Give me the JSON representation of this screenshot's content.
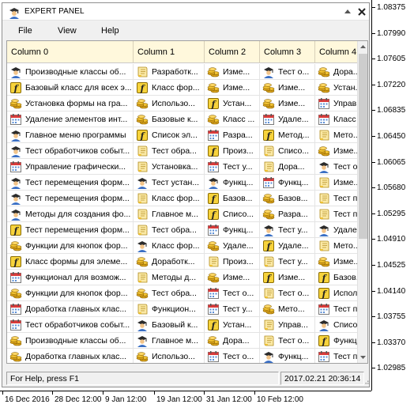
{
  "window": {
    "title": "EXPERT PANEL"
  },
  "menu": [
    "File",
    "View",
    "Help"
  ],
  "table": {
    "columns": [
      "Column 0",
      "Column 1",
      "Column 2",
      "Column 3",
      "Column 4"
    ],
    "rows": [
      [
        [
          "Производные классы об...",
          "wizard-icon"
        ],
        [
          "Разработк...",
          "scroll-icon"
        ],
        [
          "Изме...",
          "coins-icon"
        ],
        [
          "Тест о...",
          "wizard-icon"
        ],
        [
          "Дора...",
          "coins-icon"
        ]
      ],
      [
        [
          "Базовый класс для всех э...",
          "function-icon"
        ],
        [
          "Класс фор...",
          "function-icon"
        ],
        [
          "Изме...",
          "coins-icon"
        ],
        [
          "Изме...",
          "coins-icon"
        ],
        [
          "Устан...",
          "coins-icon"
        ]
      ],
      [
        [
          "Установка формы на гра...",
          "coins-icon"
        ],
        [
          "Использо...",
          "coins-icon"
        ],
        [
          "Устан...",
          "function-icon"
        ],
        [
          "Изме...",
          "coins-icon"
        ],
        [
          "Управ...",
          "calendar-icon"
        ]
      ],
      [
        [
          "Удаление элементов инт...",
          "calendar-icon"
        ],
        [
          "Базовые к...",
          "coins-icon"
        ],
        [
          "Класс ...",
          "coins-icon"
        ],
        [
          "Удале...",
          "calendar-icon"
        ],
        [
          "Класс ...",
          "calendar-icon"
        ]
      ],
      [
        [
          "Главное меню программы",
          "wizard-icon"
        ],
        [
          "Список эл...",
          "function-icon"
        ],
        [
          "Разра...",
          "calendar-icon"
        ],
        [
          "Метод...",
          "function-icon"
        ],
        [
          "Мето...",
          "scroll-icon"
        ]
      ],
      [
        [
          "Тест обработчиков событ...",
          "wizard-icon"
        ],
        [
          "Тест обра...",
          "scroll-icon"
        ],
        [
          "Произ...",
          "function-icon"
        ],
        [
          "Списо...",
          "scroll-icon"
        ],
        [
          "Изме...",
          "coins-icon"
        ]
      ],
      [
        [
          "Управление графически...",
          "calendar-icon"
        ],
        [
          "Установка...",
          "scroll-icon"
        ],
        [
          "Тест у...",
          "calendar-icon"
        ],
        [
          "Дора...",
          "scroll-icon"
        ],
        [
          "Тест о...",
          "wizard-icon"
        ]
      ],
      [
        [
          "Тест перемещения форм...",
          "wizard-icon"
        ],
        [
          "Тест устан...",
          "wizard-icon"
        ],
        [
          "Функц...",
          "wizard-icon"
        ],
        [
          "Функц...",
          "calendar-icon"
        ],
        [
          "Изме...",
          "scroll-icon"
        ]
      ],
      [
        [
          "Тест перемещения форм...",
          "wizard-icon"
        ],
        [
          "Класс фор...",
          "scroll-icon"
        ],
        [
          "Базов...",
          "function-icon"
        ],
        [
          "Базов...",
          "coins-icon"
        ],
        [
          "Тест п...",
          "scroll-icon"
        ]
      ],
      [
        [
          "Методы для создания фо...",
          "wizard-icon"
        ],
        [
          "Главное м...",
          "scroll-icon"
        ],
        [
          "Списо...",
          "function-icon"
        ],
        [
          "Разра...",
          "coins-icon"
        ],
        [
          "Тест п...",
          "scroll-icon"
        ]
      ],
      [
        [
          "Тест перемещения форм...",
          "function-icon"
        ],
        [
          "Тест обра...",
          "scroll-icon"
        ],
        [
          "Функц...",
          "calendar-icon"
        ],
        [
          "Тест у...",
          "wizard-icon"
        ],
        [
          "Удале...",
          "wizard-icon"
        ]
      ],
      [
        [
          "Функции для кнопок фор...",
          "coins-icon"
        ],
        [
          "Класс фор...",
          "wizard-icon"
        ],
        [
          "Удале...",
          "coins-icon"
        ],
        [
          "Удале...",
          "function-icon"
        ],
        [
          "Мето...",
          "scroll-icon"
        ]
      ],
      [
        [
          "Класс формы для элеме...",
          "function-icon"
        ],
        [
          "Доработк...",
          "coins-icon"
        ],
        [
          "Произ...",
          "scroll-icon"
        ],
        [
          "Тест у...",
          "scroll-icon"
        ],
        [
          "Изме...",
          "coins-icon"
        ]
      ],
      [
        [
          "Функционал для возмож...",
          "calendar-icon"
        ],
        [
          "Методы д...",
          "scroll-icon"
        ],
        [
          "Изме...",
          "coins-icon"
        ],
        [
          "Изме...",
          "function-icon"
        ],
        [
          "Базов...",
          "function-icon"
        ]
      ],
      [
        [
          "Функции для кнопок фор...",
          "coins-icon"
        ],
        [
          "Тест обра...",
          "coins-icon"
        ],
        [
          "Тест о...",
          "calendar-icon"
        ],
        [
          "Тест о...",
          "scroll-icon"
        ],
        [
          "Испол...",
          "function-icon"
        ]
      ],
      [
        [
          "Доработка главных клас...",
          "calendar-icon"
        ],
        [
          "Функцион...",
          "scroll-icon"
        ],
        [
          "Тест у...",
          "calendar-icon"
        ],
        [
          "Мето...",
          "coins-icon"
        ],
        [
          "Тест п...",
          "calendar-icon"
        ]
      ],
      [
        [
          "Тест обработчиков событ...",
          "calendar-icon"
        ],
        [
          "Базовый к...",
          "wizard-icon"
        ],
        [
          "Устан...",
          "function-icon"
        ],
        [
          "Управ...",
          "scroll-icon"
        ],
        [
          "Списо...",
          "wizard-icon"
        ]
      ],
      [
        [
          "Производные классы об...",
          "coins-icon"
        ],
        [
          "Главное м...",
          "wizard-icon"
        ],
        [
          "Дора...",
          "coins-icon"
        ],
        [
          "Тест о...",
          "scroll-icon"
        ],
        [
          "Функц...",
          "function-icon"
        ]
      ],
      [
        [
          "Доработка главных клас...",
          "coins-icon"
        ],
        [
          "Использо...",
          "coins-icon"
        ],
        [
          "Тест о...",
          "calendar-icon"
        ],
        [
          "Функц...",
          "wizard-icon"
        ],
        [
          "Тест п...",
          "calendar-icon"
        ]
      ]
    ]
  },
  "status": {
    "help": "For Help, press F1",
    "datetime": "2017.02.21 20:36:14"
  },
  "chart": {
    "price_ticks": [
      "1.08375",
      "1.07990",
      "1.07605",
      "1.07220",
      "1.06835",
      "1.06450",
      "1.06065",
      "1.05680",
      "1.05295",
      "1.04910",
      "1.04525",
      "1.04140",
      "1.03755",
      "1.03370",
      "1.02985"
    ],
    "time_ticks": [
      "16 Dec 2016",
      "28 Dec 12:00",
      "9 Jan 12:00",
      "19 Jan 12:00",
      "31 Jan 12:00",
      "10 Feb 12:00"
    ]
  },
  "colors": {
    "header_bg": "#fff8dc",
    "window_bg": "#f0f0f0",
    "grid_line": "#e4e4e4"
  }
}
